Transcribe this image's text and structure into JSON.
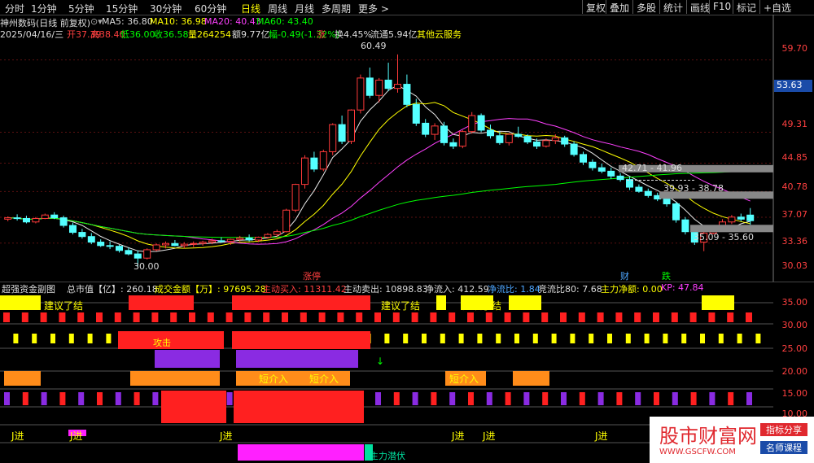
{
  "toolbar": {
    "tabs": [
      "分时",
      "1分钟",
      "5分钟",
      "15分钟",
      "30分钟",
      "60分钟",
      "日线",
      "周线",
      "月线",
      "多周期",
      "更多 >"
    ],
    "active_tab": "日线",
    "right_buttons": [
      "复权",
      "叠加",
      "多股",
      "统计",
      "画线",
      "F10",
      "标记",
      "+自选"
    ]
  },
  "stock": {
    "title": "神州数码(日线 前复权)",
    "ma5": "MA5: 36.80",
    "ma10": "MA10: 36.98",
    "ma20": "MA20: 40.43",
    "ma60": "MA60: 43.40"
  },
  "quote": {
    "date": "2025/04/16/三",
    "open": "开37.39",
    "high": "高38.40",
    "low": "低36.00",
    "close": "收36.58",
    "volume": "量264254",
    "amount": "额9.77亿",
    "change": "幅-0.49(-1.32%)",
    "turnover": "换4.45%",
    "float": "流通5.94亿",
    "service": "其他云服务"
  },
  "price_axis": {
    "ticks": [
      "59.70",
      "53.63",
      "49.31",
      "44.85",
      "40.78",
      "37.07",
      "33.36",
      "30.03"
    ],
    "current_price": "53.63"
  },
  "chart_annotations": {
    "high_label": "60.49",
    "low_label": "30.00",
    "range1": "42.71 - 41.96",
    "range2": "39.93 - 38.78",
    "range3": "35.09 - 35.60",
    "tag_up": "涨",
    "tag_limit": "涨停",
    "tag_fin": "财",
    "tag_down": "跌"
  },
  "indicator": {
    "name": "超强资金副图",
    "market_cap": "总市值【亿】: 260.18",
    "turnover_amount": "成交金额【万】: 97695.28",
    "active_buy": "主动买入: 11311.42",
    "active_sell": "主动卖出: 10898.83",
    "net_inflow": "净流入: 412.59",
    "net_ratio": "净流比: 1.84",
    "bid_ratio": "竞流比80: 7.68",
    "main_net": "主力净额: 0.00",
    "kp": "KP: 47.84",
    "axis_ticks": [
      "35.00",
      "30.00",
      "25.00",
      "20.00",
      "15.00",
      "10.00"
    ],
    "labels": {
      "sell_tip1": "建议了结",
      "sell_tip2": "建议了结",
      "sell_tip3": "建议了结",
      "short_in1": "短介入",
      "short_in2": "短介入",
      "short_in3": "短介入",
      "j_in1": "J进",
      "j_in2": "J进",
      "j_in3": "J进",
      "j_in4": "J进",
      "j_in5": "J进",
      "j_in6": "J进",
      "ambush": "主力潜伏",
      "attack": "攻击"
    }
  },
  "watermark": {
    "text": "股市财富网",
    "url": "WWW.GSCFW.COM",
    "tag1": "指标分享",
    "tag2": "名师课程"
  },
  "chart_data": {
    "type": "candlestick",
    "price_range": [
      29.0,
      62.0
    ],
    "candles": [
      [
        36.8,
        37.2,
        36.5,
        37.0
      ],
      [
        37.0,
        37.5,
        36.6,
        36.9
      ],
      [
        36.9,
        37.3,
        36.2,
        36.4
      ],
      [
        36.4,
        37.1,
        36.2,
        36.9
      ],
      [
        36.9,
        37.6,
        36.8,
        37.4
      ],
      [
        37.4,
        37.8,
        36.8,
        37.0
      ],
      [
        37.0,
        37.3,
        35.6,
        35.9
      ],
      [
        35.9,
        36.3,
        34.6,
        34.9
      ],
      [
        34.9,
        35.4,
        34.0,
        34.3
      ],
      [
        34.3,
        34.8,
        33.2,
        33.5
      ],
      [
        33.5,
        33.9,
        32.8,
        33.0
      ],
      [
        33.0,
        33.6,
        32.5,
        32.9
      ],
      [
        32.9,
        33.1,
        32.0,
        32.3
      ],
      [
        32.3,
        32.7,
        31.6,
        31.8
      ],
      [
        31.8,
        32.3,
        30.0,
        31.2
      ],
      [
        31.2,
        32.6,
        31.0,
        32.4
      ],
      [
        32.4,
        33.3,
        32.2,
        33.1
      ],
      [
        33.1,
        33.6,
        32.6,
        33.3
      ],
      [
        33.3,
        33.8,
        32.9,
        33.0
      ],
      [
        33.0,
        33.5,
        32.6,
        33.2
      ],
      [
        33.2,
        33.6,
        32.8,
        33.3
      ],
      [
        33.3,
        33.7,
        33.0,
        33.5
      ],
      [
        33.5,
        34.0,
        33.2,
        33.7
      ],
      [
        33.7,
        34.2,
        33.4,
        33.6
      ],
      [
        33.6,
        34.0,
        33.1,
        33.9
      ],
      [
        33.9,
        34.4,
        33.6,
        34.1
      ],
      [
        34.1,
        34.6,
        33.6,
        33.8
      ],
      [
        33.8,
        34.3,
        33.5,
        34.2
      ],
      [
        34.2,
        34.8,
        34.0,
        34.6
      ],
      [
        34.6,
        35.3,
        34.2,
        35.0
      ],
      [
        35.0,
        38.3,
        34.9,
        38.1
      ],
      [
        38.1,
        41.9,
        37.8,
        41.8
      ],
      [
        41.8,
        46.0,
        41.2,
        45.6
      ],
      [
        45.6,
        46.5,
        43.6,
        44.0
      ],
      [
        44.0,
        46.8,
        43.7,
        46.5
      ],
      [
        46.5,
        50.6,
        46.0,
        50.4
      ],
      [
        50.4,
        51.7,
        47.6,
        48.0
      ],
      [
        48.0,
        52.6,
        47.6,
        52.5
      ],
      [
        52.5,
        57.6,
        52.0,
        57.1
      ],
      [
        57.1,
        58.6,
        54.2,
        54.6
      ],
      [
        54.6,
        57.1,
        53.6,
        56.8
      ],
      [
        56.8,
        59.3,
        55.2,
        55.6
      ],
      [
        55.6,
        60.5,
        55.0,
        56.2
      ],
      [
        56.2,
        57.6,
        52.9,
        53.3
      ],
      [
        53.3,
        54.1,
        50.2,
        50.6
      ],
      [
        50.6,
        51.2,
        48.6,
        49.0
      ],
      [
        49.0,
        50.6,
        48.2,
        50.2
      ],
      [
        50.2,
        50.8,
        47.4,
        47.8
      ],
      [
        47.8,
        48.4,
        46.9,
        47.3
      ],
      [
        47.3,
        49.6,
        47.0,
        49.4
      ],
      [
        49.4,
        52.2,
        49.1,
        51.7
      ],
      [
        51.7,
        52.0,
        49.3,
        49.6
      ],
      [
        49.6,
        50.4,
        48.4,
        48.8
      ],
      [
        48.8,
        49.4,
        47.5,
        47.8
      ],
      [
        47.8,
        49.2,
        47.4,
        49.0
      ],
      [
        49.0,
        50.1,
        48.5,
        48.7
      ],
      [
        48.7,
        49.0,
        47.6,
        47.9
      ],
      [
        47.9,
        48.4,
        46.9,
        47.3
      ],
      [
        47.3,
        48.4,
        47.1,
        48.1
      ],
      [
        48.1,
        49.0,
        47.6,
        48.5
      ],
      [
        48.5,
        48.8,
        47.2,
        47.6
      ],
      [
        47.6,
        48.0,
        45.8,
        46.1
      ],
      [
        46.1,
        46.5,
        44.6,
        45.0
      ],
      [
        45.0,
        45.4,
        43.8,
        44.2
      ],
      [
        44.2,
        44.8,
        43.4,
        43.7
      ],
      [
        43.7,
        44.2,
        42.6,
        43.0
      ],
      [
        43.0,
        43.4,
        42.2,
        42.5
      ],
      [
        42.5,
        42.9,
        41.0,
        41.4
      ],
      [
        41.4,
        41.8,
        40.6,
        40.8
      ],
      [
        40.8,
        41.2,
        39.9,
        40.2
      ],
      [
        40.2,
        40.6,
        39.4,
        39.7
      ],
      [
        39.7,
        40.0,
        38.6,
        39.0
      ],
      [
        39.0,
        39.3,
        36.3,
        36.7
      ],
      [
        36.7,
        37.1,
        34.6,
        35.0
      ],
      [
        35.0,
        35.7,
        33.1,
        33.5
      ],
      [
        33.5,
        35.1,
        32.2,
        34.8
      ],
      [
        34.8,
        35.9,
        34.6,
        35.6
      ],
      [
        35.6,
        36.8,
        35.2,
        36.4
      ],
      [
        36.4,
        37.4,
        36.1,
        37.1
      ],
      [
        37.1,
        37.6,
        36.5,
        36.8
      ],
      [
        37.39,
        38.4,
        36.0,
        36.58
      ]
    ]
  }
}
